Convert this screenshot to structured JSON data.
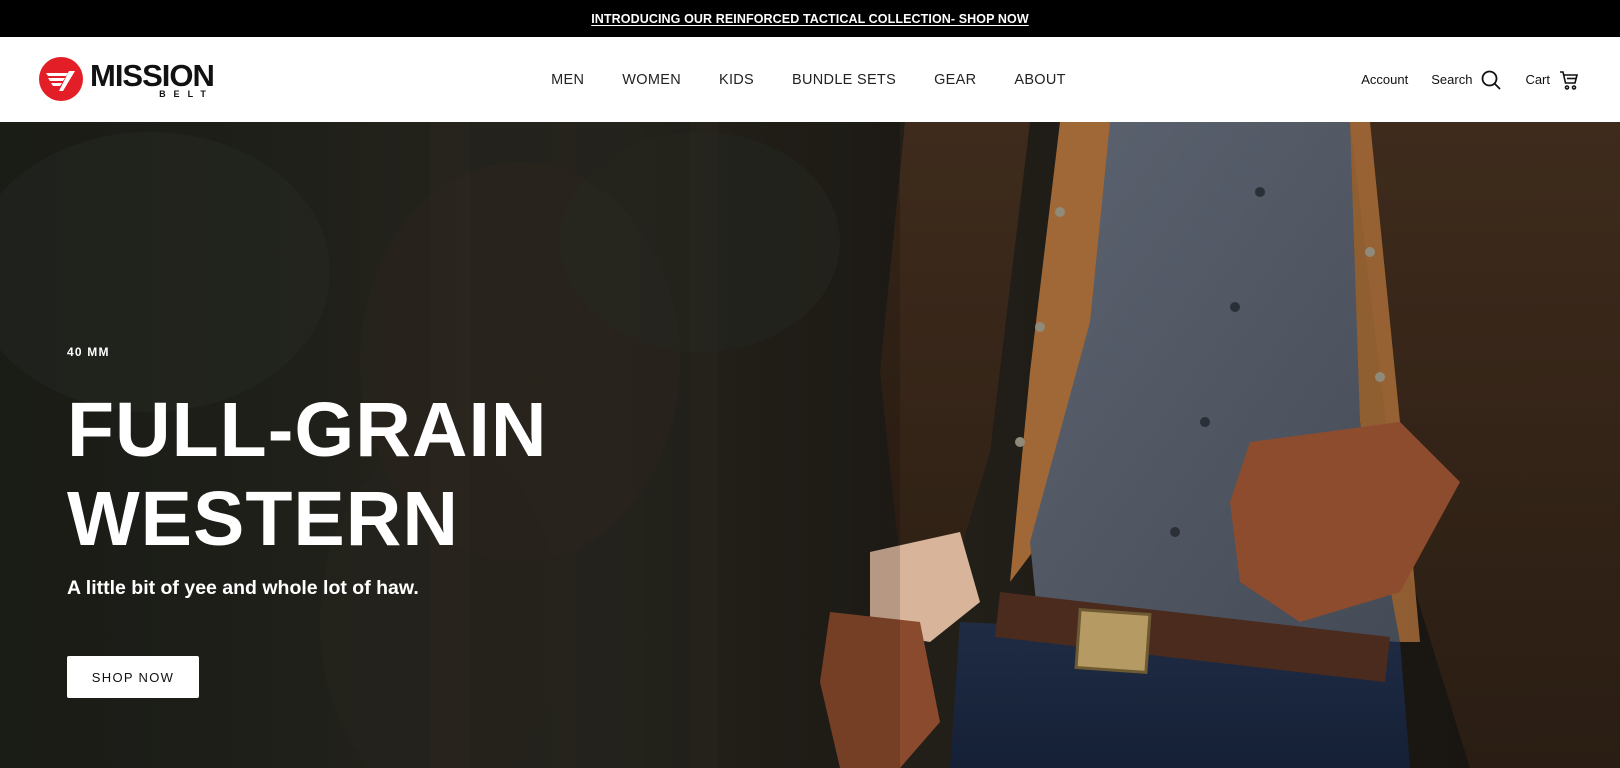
{
  "announcement": {
    "text": "INTRODUCING OUR REINFORCED TACTICAL COLLECTION- SHOP NOW"
  },
  "brand": {
    "name": "MISSION",
    "sub": "BELT",
    "accent": "#e41e26"
  },
  "nav": {
    "items": [
      {
        "label": "MEN"
      },
      {
        "label": "WOMEN"
      },
      {
        "label": "KIDS"
      },
      {
        "label": "BUNDLE SETS"
      },
      {
        "label": "GEAR"
      },
      {
        "label": "ABOUT"
      }
    ]
  },
  "utils": {
    "account": "Account",
    "search": "Search",
    "cart": "Cart"
  },
  "hero": {
    "eyebrow": "40 MM",
    "headline_line1": "FULL-GRAIN",
    "headline_line2": "WESTERN",
    "subhead": "A little bit of yee and whole lot of haw.",
    "cta": "SHOP NOW"
  },
  "icons": {
    "search": "search-icon",
    "cart": "cart-icon",
    "logo": "logo-mark-icon"
  }
}
